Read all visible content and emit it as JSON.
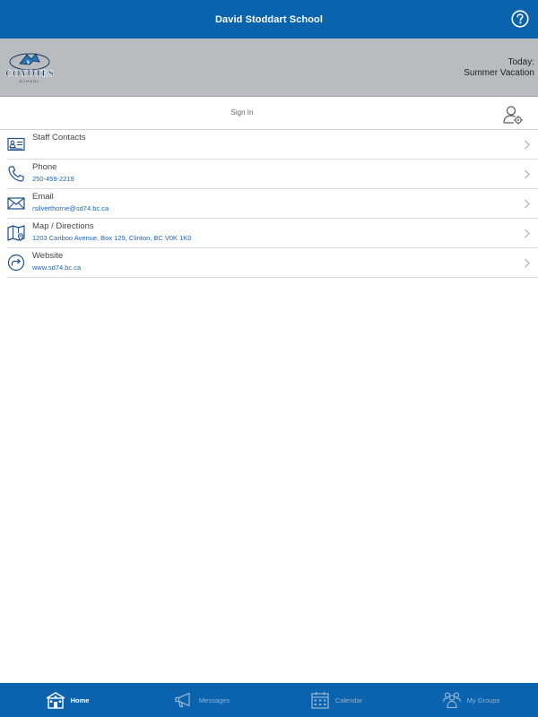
{
  "header": {
    "title": "David Stoddart School",
    "help_icon": "help-circle-icon"
  },
  "banner": {
    "logo_text": "COYOTES",
    "logo_sub": "SCHOOL",
    "today_label": "Today:",
    "today_value": "Summer Vacation"
  },
  "signin": {
    "label": "Sign In",
    "icon": "user-settings-icon"
  },
  "items": [
    {
      "title": "Staff Contacts",
      "subtitle": "",
      "icon": "contact-card-icon"
    },
    {
      "title": "Phone",
      "subtitle": "250-459-2219",
      "icon": "phone-icon"
    },
    {
      "title": "Email",
      "subtitle": "rsilverthorne@sd74.bc.ca",
      "icon": "envelope-icon"
    },
    {
      "title": "Map / Directions",
      "subtitle": "1203 Cariboo Avenue, Box 129, Clinton, BC V0K 1K0",
      "icon": "map-icon"
    },
    {
      "title": "Website",
      "subtitle": "www.sd74.bc.ca",
      "icon": "link-arrow-icon"
    }
  ],
  "tabs": [
    {
      "label": "Home",
      "icon": "school-house-icon",
      "active": true
    },
    {
      "label": "Messages",
      "icon": "megaphone-icon",
      "active": false
    },
    {
      "label": "Calendar",
      "icon": "calendar-icon",
      "active": false
    },
    {
      "label": "My Groups",
      "icon": "groups-icon",
      "active": false
    }
  ],
  "colors": {
    "brand_blue": "#0a63ac",
    "banner_gray": "#b9bcbf",
    "link_blue": "#1f64b0"
  }
}
